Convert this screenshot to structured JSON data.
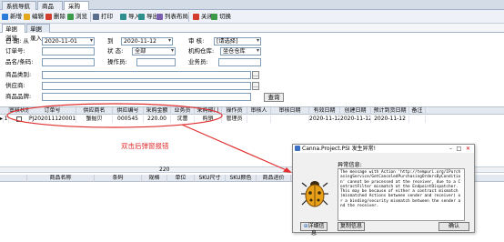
{
  "tabs": [
    "系统导航图",
    "商品档案",
    "采购订货"
  ],
  "toolbar": [
    {
      "label": "新增",
      "color": "#2b7bd8"
    },
    {
      "label": "编辑",
      "color": "#e3a81b"
    },
    {
      "label": "删除",
      "color": "#d43c2e"
    },
    {
      "label": "浏览",
      "color": "#3c9b49"
    },
    {
      "label": "打印",
      "color": "#5a6f8c"
    },
    {
      "label": "导入",
      "color": "#2f8f8f"
    },
    {
      "label": "导出",
      "color": "#2f8f8f"
    },
    {
      "label": "列表布局",
      "color": "#7a5fb0"
    },
    {
      "label": "关闭",
      "color": "#d43c2e"
    },
    {
      "label": "切换",
      "color": "#3c9b49"
    }
  ],
  "subtabs": [
    "单据浏览",
    "单据录入"
  ],
  "filters": {
    "date_label": "日 期: 从",
    "date_from": "2020-11-01",
    "to_label": "到",
    "date_to": "2020-11-12",
    "approval_label": "审 核:",
    "approval_value": "[请选择]",
    "order_label": "订单号:",
    "order_value": "",
    "status_label": "状 态:",
    "status_value": "全部",
    "warehouse_label": "机构仓库:",
    "warehouse_value": "坐仓仓库",
    "product_label": "品名/条码:",
    "product_value": "",
    "operator_label": "操作员:",
    "operator_value": "",
    "salesman_label": "业务员:",
    "salesman_value": "",
    "category_label": "商品类别:",
    "supplier_label": "供应商:",
    "brand_label": "商品品牌:",
    "query_label": "查询"
  },
  "order_table": {
    "headers": [
      "审核状态",
      "订单号",
      "供应商名",
      "供应编号",
      "采购金额",
      "业务员",
      "采购部门",
      "操作员",
      "审核人",
      "审核日期",
      "有效日期",
      "创建日期",
      "预计到货日期",
      "备注"
    ],
    "rows": [
      {
        "marker": "▸",
        "index": "1",
        "audited": false,
        "cells": [
          "PJ202011120001",
          "蟹掘贝",
          "000545",
          "220.00",
          "沈蕾",
          "购销",
          "管理员",
          "",
          "",
          "2020-11-12",
          "2020-11-12",
          "2020-11-12",
          ""
        ]
      }
    ]
  },
  "annotation_text": "双击后弹窗报错",
  "summary_total": "220",
  "detail_table": {
    "headers": [
      "商品名称",
      "条码",
      "规格",
      "单位",
      "SKU尺寸",
      "SKU颜色",
      "商品进价",
      "订单"
    ]
  },
  "dialog": {
    "title": "Canna.Project.PSI 发生异常!",
    "section_label": "异常信息:",
    "message": "The message with Action 'http://tempuri.org/IPurchasingService/GetCanceledPurchasingOrdersByCondition' cannot be processed at the receiver, due to a ContractFilter mismatch at the EndpointDispatcher. This may be because of either a contract mismatch (mismatched Actions between sender and receiver) or a binding/security mismatch between the sender and the receiver.",
    "details_label": "详细信息",
    "copy_label": "复制信息",
    "ok_label": "确认"
  },
  "colors": {
    "accent_red": "#e03030",
    "header_bg": "#e4e9f1"
  }
}
